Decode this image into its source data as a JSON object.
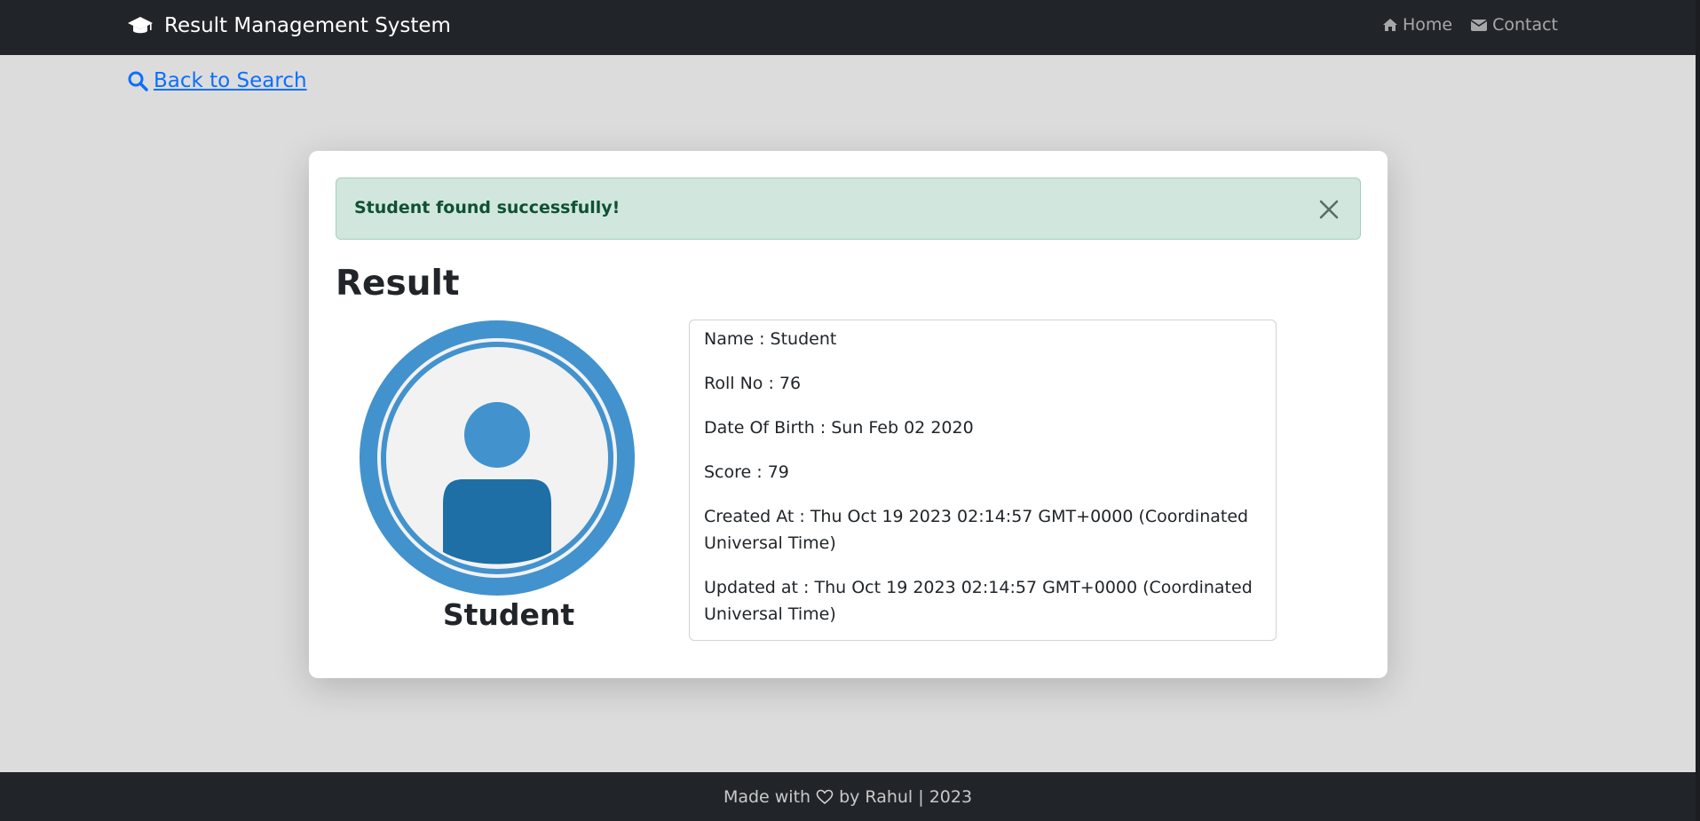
{
  "navbar": {
    "brand": {
      "icon": "graduation-cap-icon",
      "title": "Result Management System"
    },
    "links": [
      {
        "icon": "home-icon",
        "label": "Home"
      },
      {
        "icon": "envelope-icon",
        "label": "Contact"
      }
    ]
  },
  "back_link": {
    "icon": "search-icon",
    "label": "Back to Search"
  },
  "alert": {
    "message": "Student found successfully!",
    "close_icon": "close-icon"
  },
  "result": {
    "heading": "Result",
    "avatar_icon": "user-avatar-icon",
    "avatar_name": "Student",
    "details": [
      "Name : Student",
      "Roll No : 76",
      "Date Of Birth : Sun Feb 02 2020",
      "Score : 79",
      "Created At : Thu Oct 19 2023 02:14:57 GMT+0000 (Coordinated Universal Time)",
      "Updated at : Thu Oct 19 2023 02:14:57 GMT+0000 (Coordinated Universal Time)"
    ]
  },
  "footer": {
    "prefix": "Made with",
    "heart_icon": "heart-icon",
    "suffix": "by Rahul | 2023"
  },
  "colors": {
    "navbar_bg": "#212529",
    "page_bg": "#dcdcdc",
    "link": "#0d6efd",
    "alert_bg": "#d1e7dd",
    "alert_text": "#0f5132",
    "avatar_blue": "#4292cd"
  }
}
